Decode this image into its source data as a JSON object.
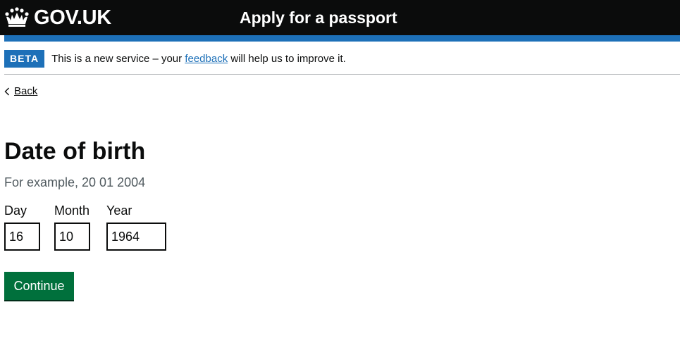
{
  "header": {
    "logo_text": "GOV.UK",
    "service_name": "Apply for a passport",
    "logo_icon": "crown-icon"
  },
  "beta_banner": {
    "tag": "BETA",
    "text_before": "This is a new service – your ",
    "link_text": "feedback",
    "text_after": " will help us to improve it."
  },
  "back_link": {
    "label": "Back",
    "icon": "chevron-left-icon"
  },
  "form": {
    "title": "Date of birth",
    "hint": "For example, 20 01 2004",
    "fields": {
      "day": {
        "label": "Day",
        "value": "16"
      },
      "month": {
        "label": "Month",
        "value": "10"
      },
      "year": {
        "label": "Year",
        "value": "1964"
      }
    },
    "continue_label": "Continue"
  },
  "colors": {
    "header_bg": "#0b0c0c",
    "brand_blue": "#1d70b8",
    "button_green": "#00703c",
    "hint_grey": "#505a5f"
  }
}
